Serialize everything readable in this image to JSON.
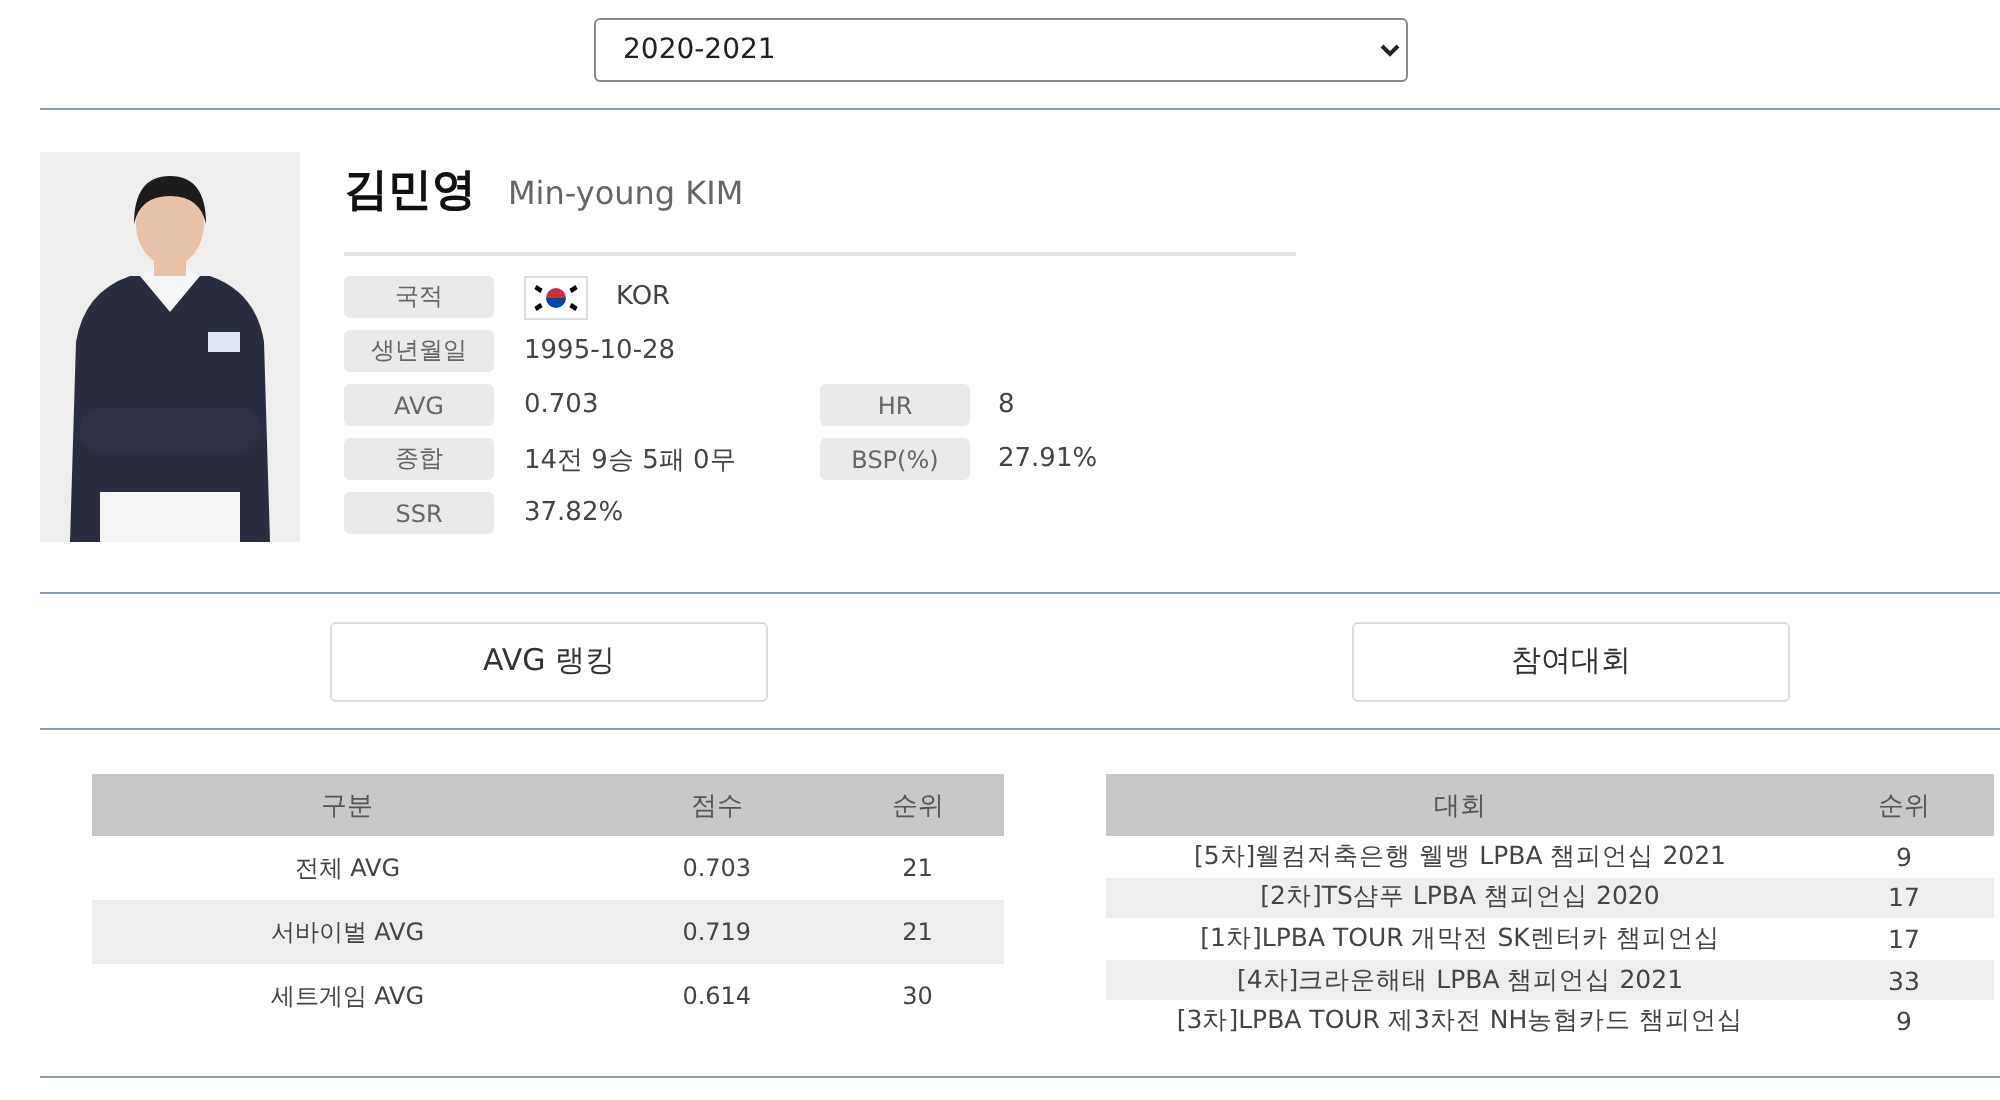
{
  "season_select": {
    "value": "2020-2021"
  },
  "player": {
    "name_ko": "김민영",
    "name_en": "Min-young KIM",
    "info": [
      {
        "label": "국적",
        "value": "KOR",
        "kind": "flag"
      },
      {
        "label": "생년월일",
        "value": "1995-10-28",
        "kind": "text"
      },
      {
        "label": "AVG",
        "value": "0.703",
        "kind": "text",
        "side_label": "HR",
        "side_value": "8"
      },
      {
        "label": "종합",
        "value": "14전 9승 5패 0무",
        "kind": "text",
        "side_label": "BSP(%)",
        "side_value": "27.91%"
      },
      {
        "label": "SSR",
        "value": "37.82%",
        "kind": "text"
      }
    ]
  },
  "section_buttons": [
    "AVG 랭킹",
    "참여대회"
  ],
  "avg_table": {
    "columns": [
      "구분",
      "점수",
      "순위"
    ],
    "rows": [
      [
        "전체 AVG",
        "0.703",
        "21"
      ],
      [
        "서바이벌 AVG",
        "0.719",
        "21"
      ],
      [
        "세트게임 AVG",
        "0.614",
        "30"
      ]
    ]
  },
  "tournament_table": {
    "columns": [
      "대회",
      "순위"
    ],
    "rows": [
      [
        "[5차]웰컴저축은행 웰뱅 LPBA 챔피언십 2021",
        "9"
      ],
      [
        "[2차]TS샴푸 LPBA 챔피언십 2020",
        "17"
      ],
      [
        "[1차]LPBA TOUR 개막전 SK렌터카 챔피언십",
        "17"
      ],
      [
        "[4차]크라운해태 LPBA 챔피언십 2021",
        "33"
      ],
      [
        "[3차]LPBA TOUR 제3차전 NH농협카드 챔피언십",
        "9"
      ]
    ]
  }
}
